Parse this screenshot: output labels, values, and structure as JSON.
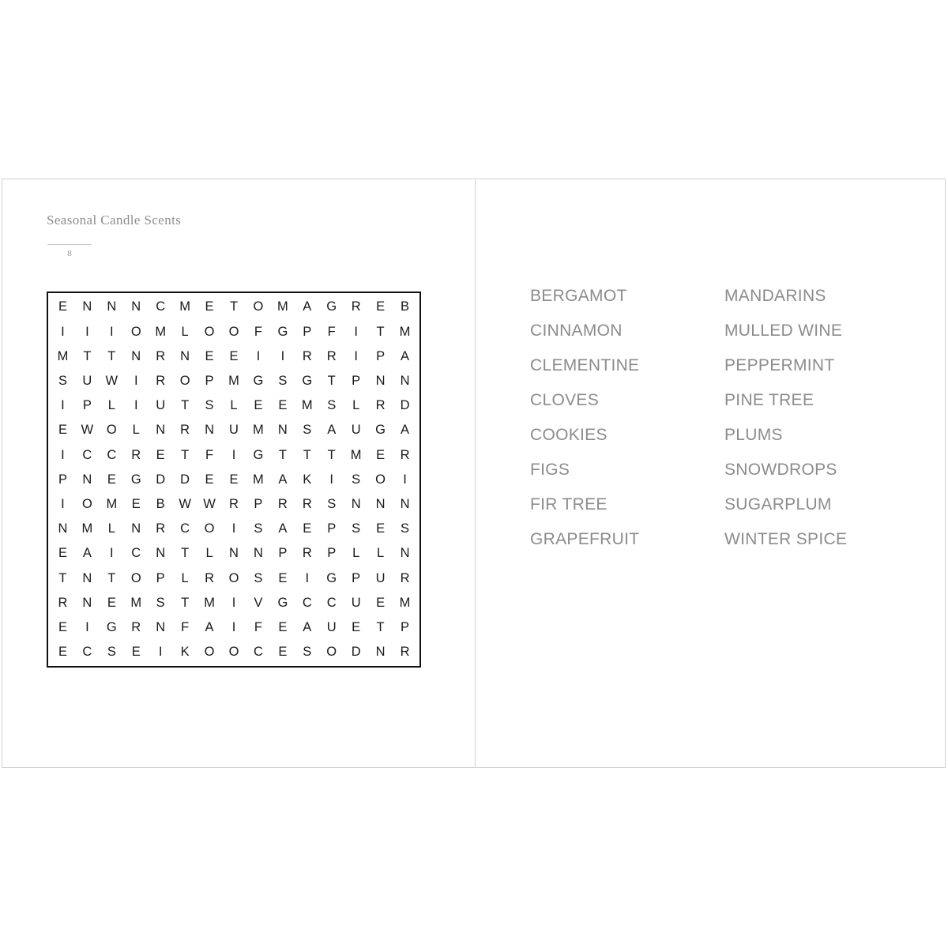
{
  "page": {
    "title": "Seasonal Candle Scents",
    "number": "8",
    "title_color": "#8d8d8d",
    "word_color": "#8c8c8c",
    "grid_border_color": "#111111",
    "page_border_color": "#d2d2d2"
  },
  "grid": {
    "rows": 15,
    "cols": 15,
    "letters": [
      [
        "E",
        "N",
        "N",
        "N",
        "C",
        "M",
        "E",
        "T",
        "O",
        "M",
        "A",
        "G",
        "R",
        "E",
        "B"
      ],
      [
        "I",
        "I",
        "I",
        "O",
        "M",
        "L",
        "O",
        "O",
        "F",
        "G",
        "P",
        "F",
        "I",
        "T",
        "M"
      ],
      [
        "M",
        "T",
        "T",
        "N",
        "R",
        "N",
        "E",
        "E",
        "I",
        "I",
        "R",
        "R",
        "I",
        "P",
        "A"
      ],
      [
        "S",
        "U",
        "W",
        "I",
        "R",
        "O",
        "P",
        "M",
        "G",
        "S",
        "G",
        "T",
        "P",
        "N",
        "N"
      ],
      [
        "I",
        "P",
        "L",
        "I",
        "U",
        "T",
        "S",
        "L",
        "E",
        "E",
        "M",
        "S",
        "L",
        "R",
        "D"
      ],
      [
        "E",
        "W",
        "O",
        "L",
        "N",
        "R",
        "N",
        "U",
        "M",
        "N",
        "S",
        "A",
        "U",
        "G",
        "A"
      ],
      [
        "I",
        "C",
        "C",
        "R",
        "E",
        "T",
        "F",
        "I",
        "G",
        "T",
        "T",
        "T",
        "M",
        "E",
        "R"
      ],
      [
        "P",
        "N",
        "E",
        "G",
        "D",
        "D",
        "E",
        "E",
        "M",
        "A",
        "K",
        "I",
        "S",
        "O",
        "I"
      ],
      [
        "I",
        "O",
        "M",
        "E",
        "B",
        "W",
        "W",
        "R",
        "P",
        "R",
        "R",
        "S",
        "N",
        "N",
        "N"
      ],
      [
        "N",
        "M",
        "L",
        "N",
        "R",
        "C",
        "O",
        "I",
        "S",
        "A",
        "E",
        "P",
        "S",
        "E",
        "S"
      ],
      [
        "E",
        "A",
        "I",
        "C",
        "N",
        "T",
        "L",
        "N",
        "N",
        "P",
        "R",
        "P",
        "L",
        "L",
        "N"
      ],
      [
        "T",
        "N",
        "T",
        "O",
        "P",
        "L",
        "R",
        "O",
        "S",
        "E",
        "I",
        "G",
        "P",
        "U",
        "R"
      ],
      [
        "R",
        "N",
        "E",
        "M",
        "S",
        "T",
        "M",
        "I",
        "V",
        "G",
        "C",
        "C",
        "U",
        "E",
        "M"
      ],
      [
        "E",
        "I",
        "G",
        "R",
        "N",
        "F",
        "A",
        "I",
        "F",
        "E",
        "A",
        "U",
        "E",
        "T",
        "P"
      ],
      [
        "E",
        "C",
        "S",
        "E",
        "I",
        "K",
        "O",
        "O",
        "C",
        "E",
        "S",
        "O",
        "D",
        "N",
        "R"
      ]
    ]
  },
  "word_list": {
    "columns": [
      {
        "words": [
          "BERGAMOT",
          "CINNAMON",
          "CLEMENTINE",
          "CLOVES",
          "COOKIES",
          "FIGS",
          "FIR TREE",
          "GRAPEFRUIT"
        ]
      },
      {
        "words": [
          "MANDARINS",
          "MULLED WINE",
          "PEPPERMINT",
          "PINE TREE",
          "PLUMS",
          "SNOWDROPS",
          "SUGARPLUM",
          "WINTER SPICE"
        ]
      }
    ]
  }
}
